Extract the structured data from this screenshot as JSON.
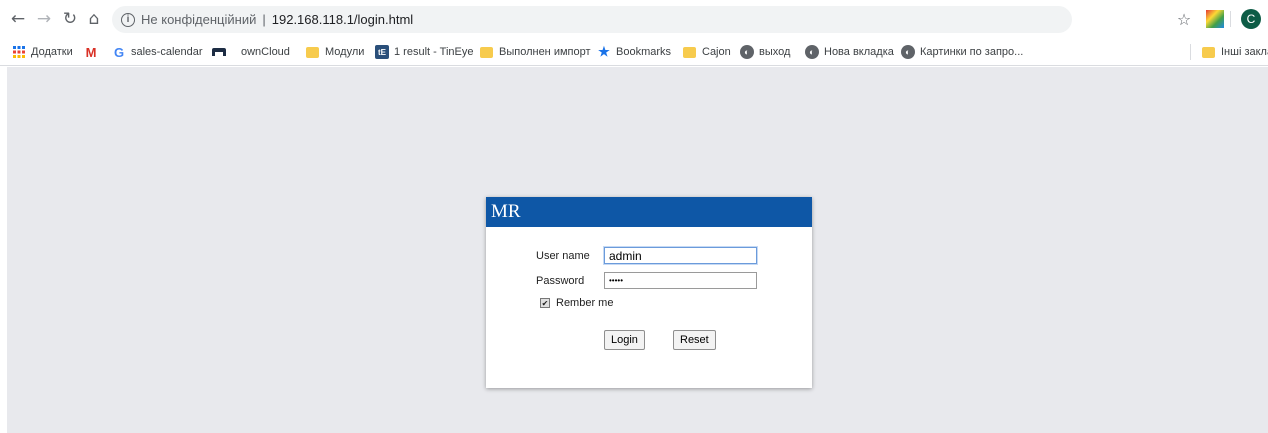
{
  "browser": {
    "security_label": "Не конфіденційний",
    "separator": "|",
    "url": "192.168.118.1/login.html",
    "profile_initial": "C"
  },
  "bookmarks": {
    "items": [
      {
        "label": "Додатки",
        "icon": "apps-grid-icon"
      },
      {
        "label": "",
        "icon": "gmail-icon"
      },
      {
        "label": "sales-calendar",
        "icon": "google-icon"
      },
      {
        "label": "ownCloud",
        "icon": "owncloud-icon"
      },
      {
        "label": "Модули",
        "icon": "folder-icon"
      },
      {
        "label": "1 result - TinEye",
        "icon": "tineye-icon"
      },
      {
        "label": "Выполнен импорт",
        "icon": "folder-icon"
      },
      {
        "label": "Bookmarks",
        "icon": "star-icon"
      },
      {
        "label": "Cajon",
        "icon": "folder-icon"
      },
      {
        "label": "выход",
        "icon": "globe-icon"
      },
      {
        "label": "Нова вкладка",
        "icon": "globe-icon"
      },
      {
        "label": "Картинки по запро...",
        "icon": "globe-icon"
      }
    ],
    "other": "Інші закла"
  },
  "login": {
    "title": "MR",
    "username_label": "User name",
    "username_value": "admin",
    "password_label": "Password",
    "password_value": "•••••",
    "remember_label": "Rember me",
    "remember_checked": true,
    "login_button": "Login",
    "reset_button": "Reset"
  },
  "colors": {
    "header": "#0e57a6",
    "page_bg": "#e8e9ed"
  }
}
